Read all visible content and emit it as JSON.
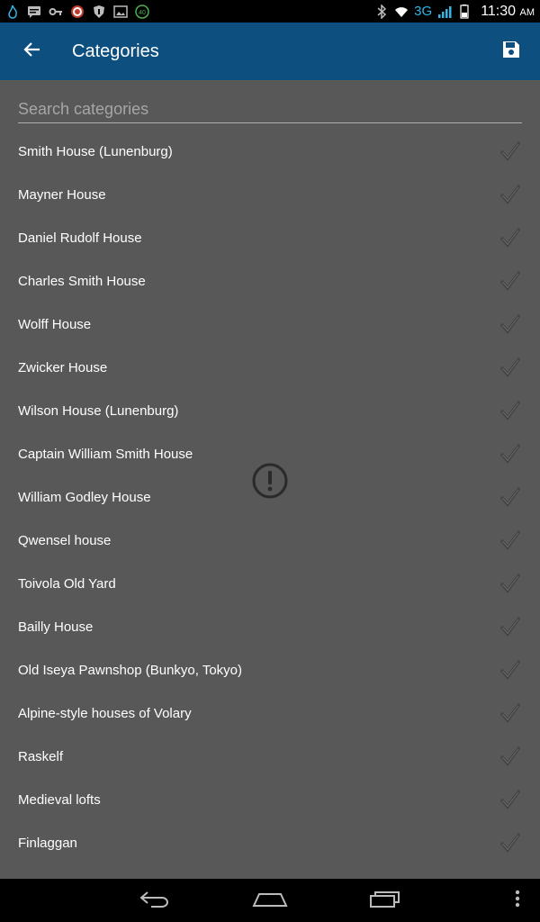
{
  "status_bar": {
    "network": "3G",
    "time": "11:30",
    "ampm": "AM",
    "notification_badge": "40"
  },
  "app_bar": {
    "title": "Categories"
  },
  "search": {
    "placeholder": "Search categories"
  },
  "categories": [
    "Smith House (Lunenburg)",
    "Mayner House",
    "Daniel Rudolf House",
    "Charles Smith House",
    "Wolff House",
    "Zwicker House",
    "Wilson House (Lunenburg)",
    "Captain William Smith House",
    "William Godley House",
    "Qwensel house",
    "Toivola Old Yard",
    "Bailly House",
    "Old Iseya Pawnshop (Bunkyo, Tokyo)",
    "Alpine-style houses of Volary",
    "Raskelf",
    "Medieval lofts",
    "Finlaggan"
  ],
  "colors": {
    "app_bar": "#0d4f7f",
    "content_bg": "#585858",
    "accent": "#33b5e5"
  }
}
